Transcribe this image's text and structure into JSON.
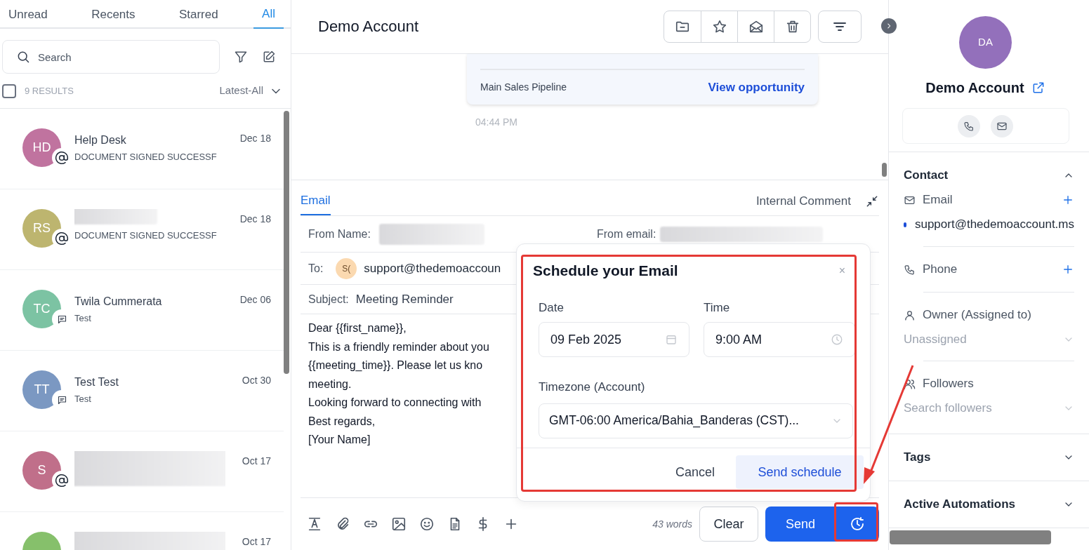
{
  "tabs": [
    {
      "label": "Unread",
      "selected": false
    },
    {
      "label": "Recents",
      "selected": false
    },
    {
      "label": "Starred",
      "selected": false
    },
    {
      "label": "All",
      "selected": true
    }
  ],
  "search": {
    "placeholder": "Search"
  },
  "results": {
    "checked": false,
    "count": "9 RESULTS",
    "sort": "Latest-All"
  },
  "conversations": [
    {
      "initials": "HD",
      "color": "#c0739f",
      "name": "Help Desk",
      "date": "Dec 18",
      "kind": "email",
      "preview": "DOCUMENT SIGNED SUCCESSF"
    },
    {
      "initials": "RS",
      "color": "#bdb56f",
      "date": "Dec 18",
      "kind": "email",
      "preview": "DOCUMENT SIGNED SUCCESSF"
    },
    {
      "initials": "TC",
      "color": "#7cc3a3",
      "name": "Twila Cummerata",
      "date": "Dec 06",
      "kind": "chat",
      "preview": "Test"
    },
    {
      "initials": "TT",
      "color": "#7b98c2",
      "name": "Test Test",
      "date": "Oct 30",
      "kind": "chat",
      "preview": "Test"
    },
    {
      "initials": "S",
      "color": "#c06f8a",
      "date": "Oct 17",
      "kind": "email"
    },
    {
      "color": "#86c06b",
      "date": "Oct 17"
    }
  ],
  "header": {
    "title": "Demo Account"
  },
  "message": {
    "pipeline": "Main Sales Pipeline",
    "link": "View opportunity",
    "time": "04:44 PM"
  },
  "composer": {
    "tabs": [
      {
        "label": "Email",
        "selected": true
      },
      {
        "label": "Internal Comment",
        "selected": false
      }
    ],
    "from_name_label": "From Name:",
    "from_email_label": "From email:",
    "to_label": "To:",
    "to_initials": "S(",
    "to_value": "support@thedemoaccoun",
    "subject_label": "Subject:",
    "subject": "Meeting Reminder",
    "body": [
      "Dear {{first_name}},",
      "This is a friendly reminder about you",
      "{{meeting_time}}. Please let us kno",
      "meeting.",
      "Looking forward to connecting with",
      "Best regards,",
      "[Your Name]"
    ],
    "word_count": "43 words",
    "clear": "Clear",
    "send": "Send"
  },
  "schedule": {
    "title": "Schedule your Email",
    "close": "×",
    "date_label": "Date",
    "date": "09 Feb 2025",
    "time_label": "Time",
    "time": "9:00 AM",
    "timezone_label": "Timezone (Account)",
    "timezone": "GMT-06:00 America/Bahia_Banderas (CST)...",
    "cancel": "Cancel",
    "submit": "Send schedule"
  },
  "contact": {
    "initials": "DA",
    "name": "Demo Account",
    "sections": [
      {
        "title": "Contact",
        "expanded": true
      },
      {
        "title": "Tags",
        "expanded": false
      },
      {
        "title": "Active Automations",
        "expanded": false
      }
    ],
    "email_label": "Email",
    "email": "support@thedemoaccount.ms",
    "phone_label": "Phone",
    "owner_label": "Owner (Assigned to)",
    "owner": "Unassigned",
    "followers_label": "Followers",
    "followers_placeholder": "Search followers"
  }
}
